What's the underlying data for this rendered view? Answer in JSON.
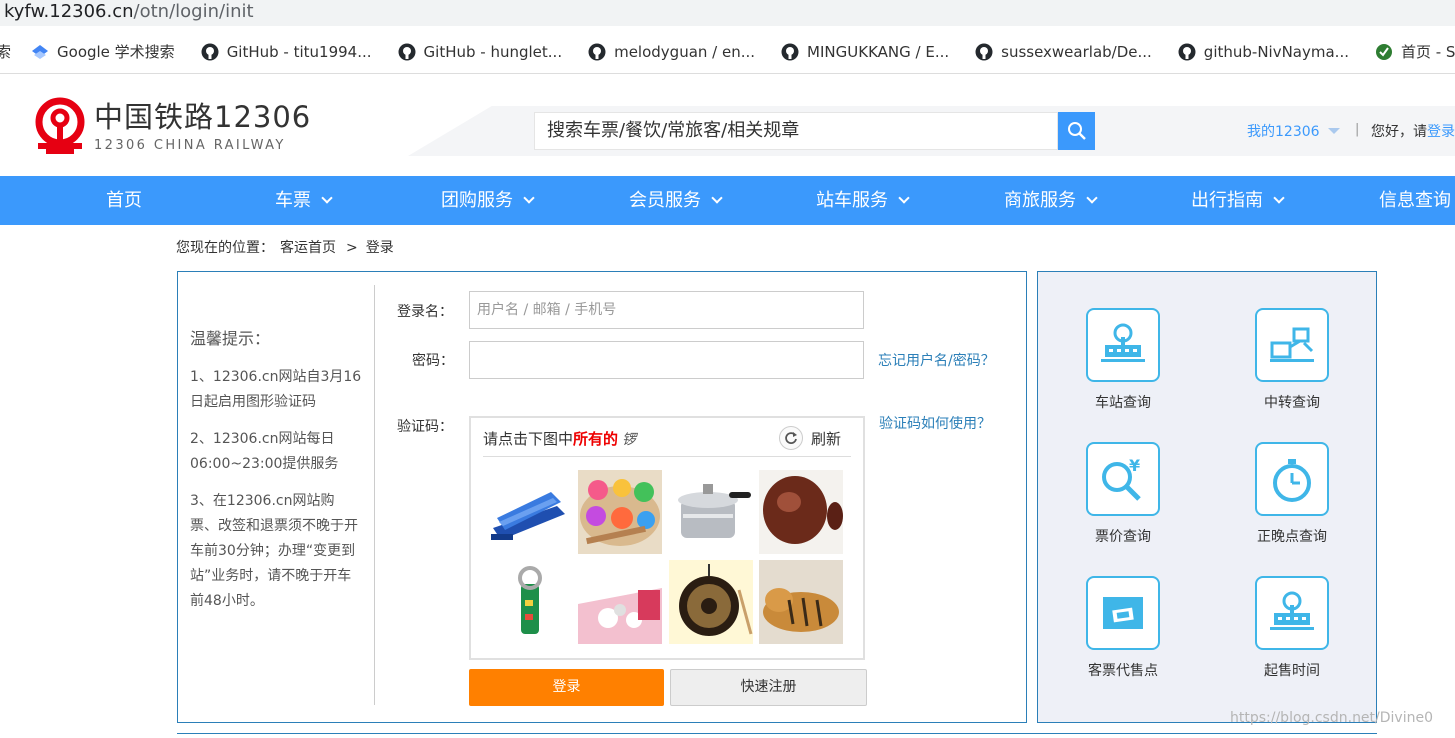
{
  "browser": {
    "url_host": "kyfw.12306.cn",
    "url_path": "/otn/login/init",
    "bookmarks": [
      {
        "label": "索",
        "icon": "partial-icon"
      },
      {
        "label": "Google 学术搜索",
        "icon": "scholar-icon"
      },
      {
        "label": "GitHub - titu1994...",
        "icon": "github-icon"
      },
      {
        "label": "GitHub - hunglet...",
        "icon": "github-icon"
      },
      {
        "label": "melodyguan / en...",
        "icon": "github-icon"
      },
      {
        "label": "MINGUKKANG / E...",
        "icon": "github-icon"
      },
      {
        "label": "sussexwearlab/De...",
        "icon": "github-icon"
      },
      {
        "label": "github-NivNayma...",
        "icon": "github-icon"
      },
      {
        "label": "首页 - Sha",
        "icon": "globe-icon"
      }
    ]
  },
  "header": {
    "logo_cn": "中国铁路12306",
    "logo_en": "12306 CHINA RAILWAY",
    "search_placeholder": "搜索车票/餐饮/常旅客/相关规章",
    "my12306": "我的12306",
    "separator": "|",
    "greeting": "您好，请",
    "login_link": "登录"
  },
  "nav": [
    {
      "label": "首页",
      "dropdown": false
    },
    {
      "label": "车票",
      "dropdown": true
    },
    {
      "label": "团购服务",
      "dropdown": true
    },
    {
      "label": "会员服务",
      "dropdown": true
    },
    {
      "label": "站车服务",
      "dropdown": true
    },
    {
      "label": "商旅服务",
      "dropdown": true
    },
    {
      "label": "出行指南",
      "dropdown": true
    },
    {
      "label": "信息查询",
      "dropdown": false
    }
  ],
  "breadcrumb": {
    "prefix": "您现在的位置：",
    "home": "客运首页",
    "arrow": ">",
    "current": "登录"
  },
  "tips": {
    "title": "温馨提示：",
    "items": [
      "1、12306.cn网站自3月16日起启用图形验证码",
      "2、12306.cn网站每日06:00~23:00提供服务",
      "3、在12306.cn网站购票、改签和退票须不晚于开车前30分钟；办理“变更到站”业务时，请不晚于开车前48小时。"
    ]
  },
  "login": {
    "username_label": "登录名：",
    "username_placeholder": "用户名 / 邮箱 / 手机号",
    "password_label": "密码：",
    "password_value": "",
    "forgot_link": "忘记用户名/密码？",
    "captcha_label": "验证码：",
    "captcha_help_link": "验证码如何使用？",
    "captcha_prompt_prefix": "请点击下图中",
    "captcha_prompt_emph": "所有的",
    "captcha_prompt_glyph": "锣",
    "captcha_refresh": "刷新",
    "login_button": "登录",
    "register_button": "快速注册"
  },
  "services": [
    {
      "label": "车站查询",
      "icon": "station-icon"
    },
    {
      "label": "中转查询",
      "icon": "transfer-icon"
    },
    {
      "label": "票价查询",
      "icon": "fare-search-icon"
    },
    {
      "label": "正晚点查询",
      "icon": "stopwatch-icon"
    },
    {
      "label": "客票代售点",
      "icon": "ticket-agency-icon"
    },
    {
      "label": "起售时间",
      "icon": "sale-time-icon"
    }
  ],
  "watermark": "https://blog.csdn.net/Divine0",
  "colors": {
    "nav_blue": "#3b99fc",
    "login_orange": "#ff8000",
    "logo_red": "#e60012",
    "border_blue": "#2b7fb8",
    "icon_cyan": "#3fb6e8"
  }
}
